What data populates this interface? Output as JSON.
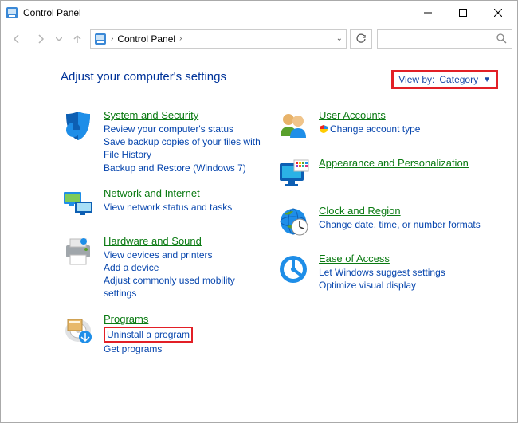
{
  "window": {
    "title": "Control Panel"
  },
  "nav": {
    "crumb": "Control Panel"
  },
  "body": {
    "heading": "Adjust your computer's settings",
    "viewby": {
      "label": "View by:",
      "value": "Category"
    },
    "left": {
      "system": {
        "title": "System and Security",
        "links": [
          "Review your computer's status",
          "Save backup copies of your files with File History",
          "Backup and Restore (Windows 7)"
        ]
      },
      "network": {
        "title": "Network and Internet",
        "links": [
          "View network status and tasks"
        ]
      },
      "hardware": {
        "title": "Hardware and Sound",
        "links": [
          "View devices and printers",
          "Add a device",
          "Adjust commonly used mobility settings"
        ]
      },
      "programs": {
        "title": "Programs",
        "links": [
          "Uninstall a program",
          "Get programs"
        ]
      }
    },
    "right": {
      "accounts": {
        "title": "User Accounts",
        "links": [
          "Change account type"
        ]
      },
      "appearance": {
        "title": "Appearance and Personalization"
      },
      "clock": {
        "title": "Clock and Region",
        "links": [
          "Change date, time, or number formats"
        ]
      },
      "ease": {
        "title": "Ease of Access",
        "links": [
          "Let Windows suggest settings",
          "Optimize visual display"
        ]
      }
    }
  }
}
